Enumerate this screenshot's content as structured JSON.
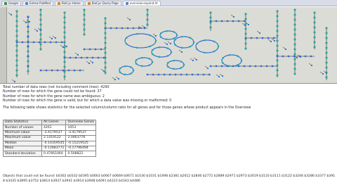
{
  "browser": {
    "tabs": [
      {
        "label": "Google",
        "icon": "google-icon"
      },
      {
        "label": "Entrez PubMed",
        "icon": "pubmed-icon"
      },
      {
        "label": "BioCyc Home",
        "icon": "biocyc-icon"
      },
      {
        "label": "BioCyc Query Page",
        "icon": "biocyc-icon"
      },
      {
        "label": "overview-expand.ht",
        "icon": "page-icon"
      }
    ],
    "active_tab": 4
  },
  "info": {
    "total_rows": "Total number of data rows (not including comment lines): 4290",
    "not_found_rows": "Number of rows for which the gene could not be found: 37",
    "ambiguous_rows": "Number of rows for which the gene name was ambiguous: 2",
    "missing_rows": "Number of rows for which the gene is valid, but for which a data value was missing or malformed: 0",
    "table_intro": "The following table shows statistics for the selected column/column ratio for all genes and for those genes whose product appears in the Overview"
  },
  "stats_table": {
    "headers": [
      "Data Statistics",
      "All Genes",
      "Overview Genes"
    ],
    "rows": [
      {
        "label": "Number of values",
        "all": "4261",
        "overview": "1053"
      },
      {
        "label": "Minimum value",
        "all": "-3.4179537",
        "overview": "-3.4179537"
      },
      {
        "label": "Maximum value",
        "all": "2.1419122",
        "overview": "2.0463776"
      },
      {
        "label": "Median",
        "all": "-0.10359545",
        "overview": "-0.15219525"
      },
      {
        "label": "Mean",
        "all": "-0.12683771",
        "overview": "-0.17796494"
      },
      {
        "label": "Standard deviation",
        "all": "0.47661064",
        "overview": "0.508822"
      }
    ]
  },
  "not_found": {
    "label": "Objects that could not be found:",
    "ids": "b0302 b0332 b0395 b0663 b0667 b0669 b0671 b1030 b1031 b1698 b2381 b2612 b2846 b2772 b2889 b2971 b2973 b3019 b3110 b3111 b3122 b3246 b3286 b3377 b3918 b3435 b3895 b3752 b3814 b3937 b3941 b3914 b3948 b4091 b4223 b4343 b4486"
  },
  "colors": {
    "diagram_bg": "#dcdcd6",
    "node_blue": "#2f6fd6",
    "node_teal": "#2aa89a",
    "edge_gray": "#555555"
  }
}
